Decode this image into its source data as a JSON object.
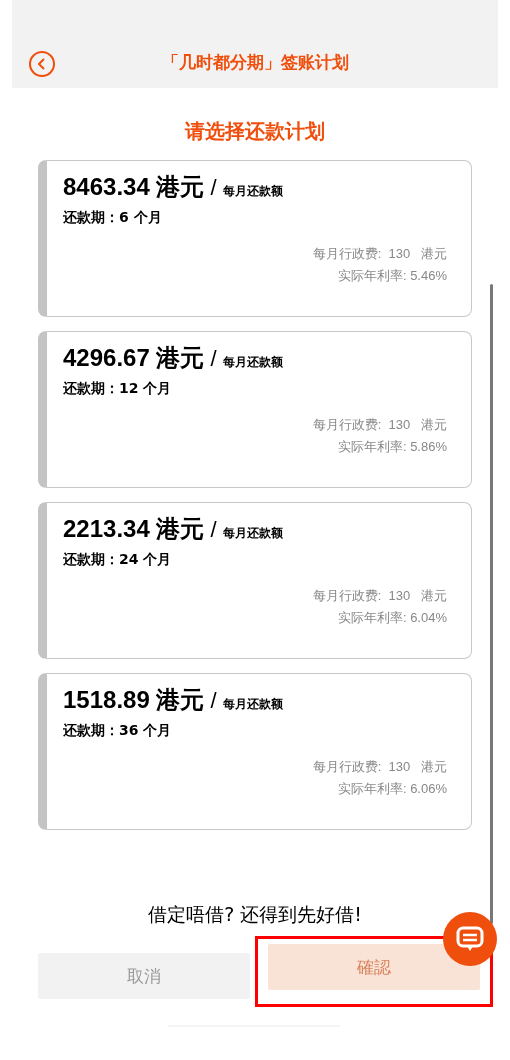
{
  "header": {
    "title": "「几时都分期」签账计划"
  },
  "subtitle": "请选择还款计划",
  "plans": [
    {
      "amount": "8463.34 港元",
      "separator": "/",
      "amount_label": "每月还款额",
      "term": "还款期：6 个月",
      "fee": "每月行政费:  130   港元",
      "rate": "实际年利率: 5.46%"
    },
    {
      "amount": "4296.67 港元",
      "separator": "/",
      "amount_label": "每月还款额",
      "term": "还款期：12 个月",
      "fee": "每月行政费:  130   港元",
      "rate": "实际年利率: 5.86%"
    },
    {
      "amount": "2213.34 港元",
      "separator": "/",
      "amount_label": "每月还款额",
      "term": "还款期：24 个月",
      "fee": "每月行政费:  130   港元",
      "rate": "实际年利率: 6.04%"
    },
    {
      "amount": "1518.89 港元",
      "separator": "/",
      "amount_label": "每月还款额",
      "term": "还款期：36 个月",
      "fee": "每月行政费:  130   港元",
      "rate": "实际年利率: 6.06%"
    }
  ],
  "slogan": "借定唔借? 还得到先好借!",
  "buttons": [
    {
      "label": "取消",
      "kind": "cancel",
      "disabled": false,
      "highlighted": false
    },
    {
      "label": "確認",
      "kind": "confirm",
      "disabled": true,
      "highlighted": true
    }
  ]
}
